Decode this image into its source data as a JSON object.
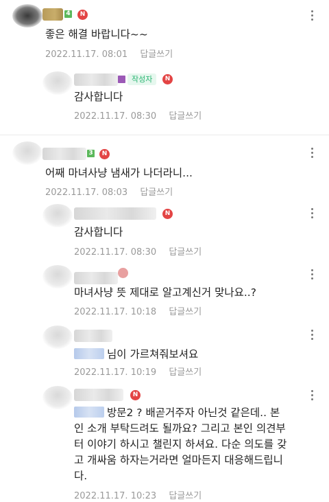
{
  "comments": [
    {
      "level": "4",
      "new_badge": "N",
      "text": "좋은 해결 바랍니다~~",
      "date": "2022.11.17. 08:01",
      "reply_label": "답글쓰기"
    },
    {
      "level": "",
      "author_badge": "작성자",
      "new_badge": "N",
      "text": "감사합니다",
      "date": "2022.11.17. 08:30",
      "reply_label": "답글쓰기"
    },
    {
      "level": "3",
      "new_badge": "N",
      "text": "어째 마녀사냥 냄새가 나더라니...",
      "date": "2022.11.17. 08:03",
      "reply_label": "답글쓰기"
    },
    {
      "new_badge": "N",
      "text": "감사합니다",
      "date": "2022.11.17. 08:30",
      "reply_label": "답글쓰기"
    },
    {
      "text": "마녀사냥 뜻 제대로 알고계신거 맞나요..?",
      "date": "2022.11.17. 10:18",
      "reply_label": "답글쓰기"
    },
    {
      "text": "님이 가르쳐줘보셔요",
      "date": "2022.11.17. 10:19",
      "reply_label": "답글쓰기"
    },
    {
      "new_badge": "N",
      "text_lines": [
        "방문2 ? 배곧거주자 아닌것 같은데.. 본",
        "인 소개 부탁드려도 될까요? 그리고 본인 의견부",
        "터 이야기 하시고 챌린지 하셔요. 다순 의도를 갖",
        "고 개싸움 하자는거라면 얼마든지 대응해드립니",
        "다."
      ],
      "date": "2022.11.17. 10:23",
      "reply_label": "답글쓰기"
    }
  ]
}
